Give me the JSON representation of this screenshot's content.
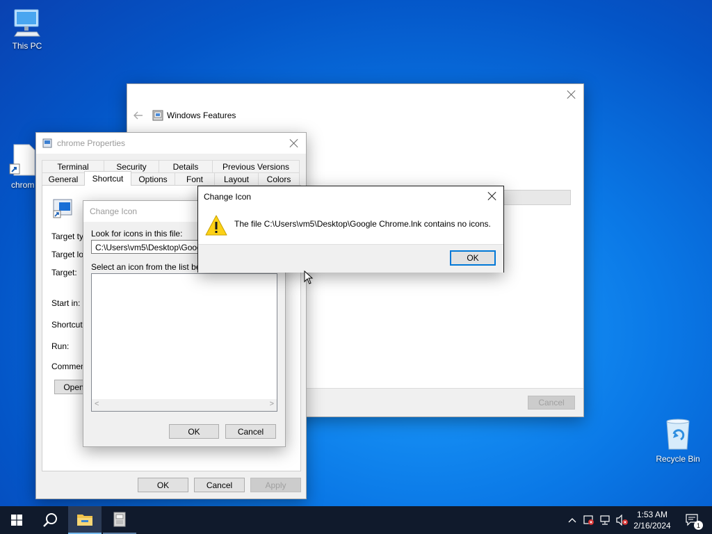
{
  "desktop": {
    "this_pc_label": "This PC",
    "chrome_shortcut_label": "chrom",
    "recycle_bin_label": "Recycle Bin"
  },
  "windows_features": {
    "title": "Windows Features",
    "cancel_label": "Cancel"
  },
  "chrome_properties": {
    "title": "chrome Properties",
    "tabs_row1": [
      "Terminal",
      "Security",
      "Details",
      "Previous Versions"
    ],
    "tabs_row2": [
      "General",
      "Shortcut",
      "Options",
      "Font",
      "Layout",
      "Colors"
    ],
    "active_tab": "Shortcut",
    "fields": {
      "target_type": "Target typ",
      "target_location": "Target loc",
      "target": "Target:",
      "start_in": "Start in:",
      "shortcut_key": "Shortcut k",
      "run": "Run:",
      "comment": "Comment:"
    },
    "open_button": "Open",
    "ok_label": "OK",
    "cancel_label": "Cancel",
    "apply_label": "Apply"
  },
  "change_icon_picker": {
    "title": "Change Icon",
    "look_for_label": "Look for icons in this file:",
    "file_path": "C:\\Users\\vm5\\Desktop\\Google",
    "select_label": "Select an icon from the list below",
    "ok_label": "OK",
    "cancel_label": "Cancel"
  },
  "change_icon_error": {
    "title": "Change Icon",
    "message": "The file C:\\Users\\vm5\\Desktop\\Google Chrome.lnk contains no icons.",
    "ok_label": "OK"
  },
  "taskbar": {
    "time": "1:53 AM",
    "date": "2/16/2024",
    "notification_count": "1"
  },
  "colors": {
    "accent": "#0078d7",
    "taskbar": "#101a2c"
  }
}
